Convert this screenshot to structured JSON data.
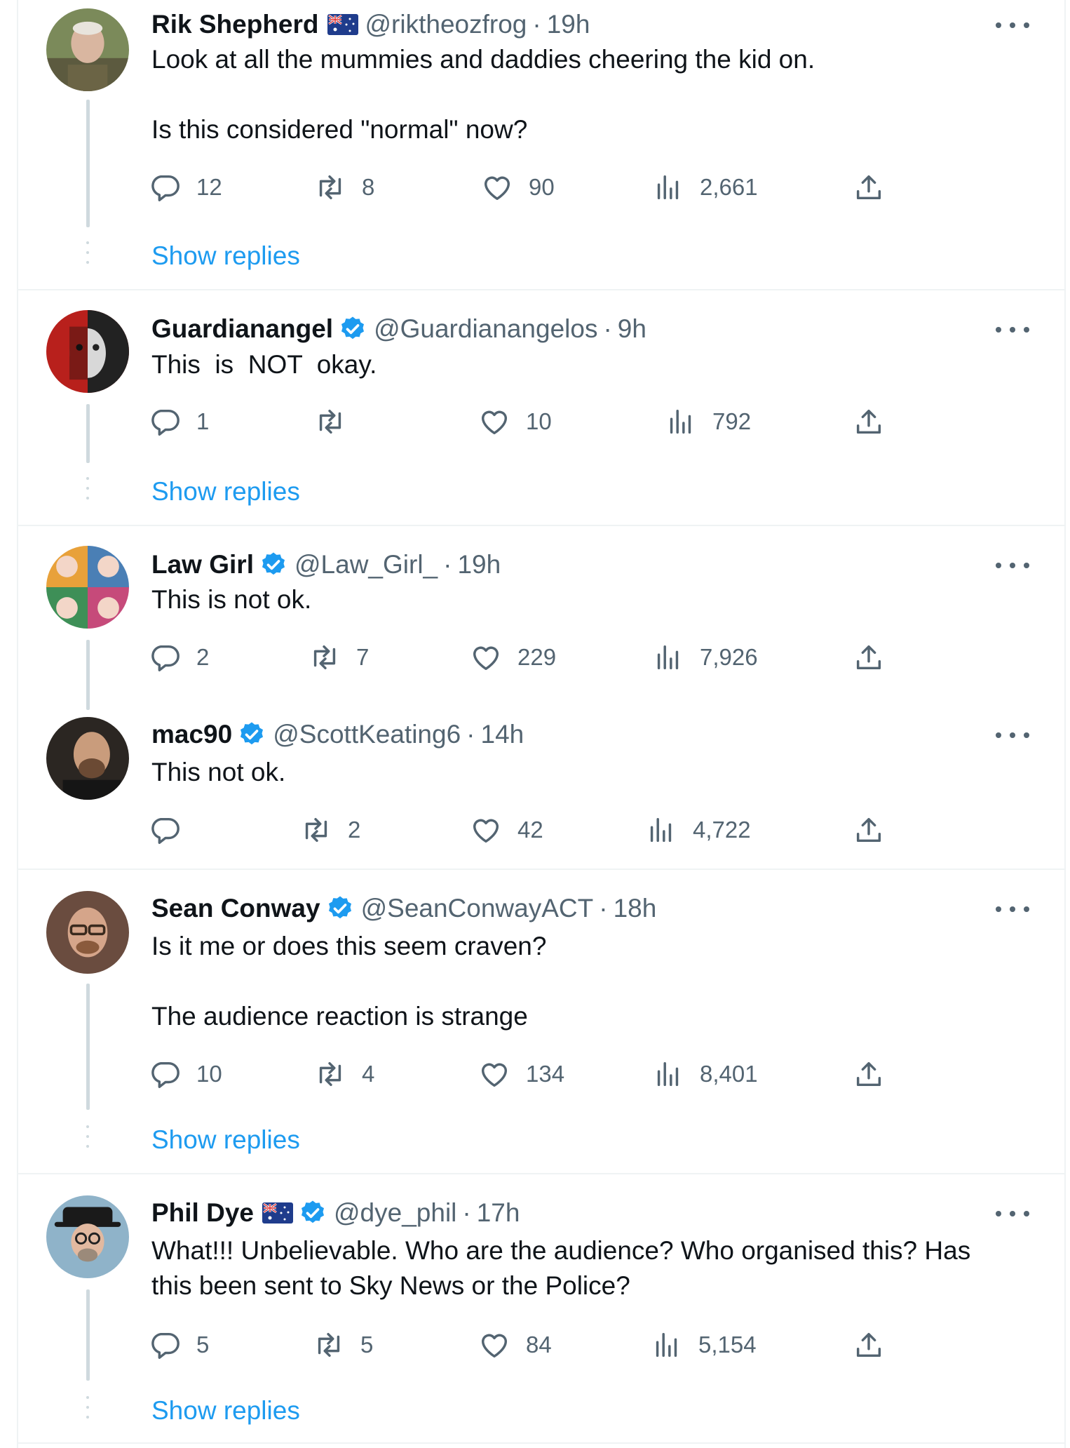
{
  "tweets": [
    {
      "name": "Rik Shepherd",
      "flag": "australian-flag",
      "verified": false,
      "handle": "@riktheozfrog",
      "sep": "·",
      "time": "19h",
      "text": "Look at all the mummies and daddies cheering the kid on.\n\nIs this considered \"normal\" now?",
      "replies": "12",
      "retweets": "8",
      "likes": "90",
      "views": "2,661",
      "show_replies": "Show replies"
    },
    {
      "name": "Guardianangel",
      "verified": true,
      "handle": "@Guardianangelos",
      "sep": "·",
      "time": "9h",
      "text": "This  is  NOT  okay.",
      "replies": "1",
      "retweets": "",
      "likes": "10",
      "views": "792",
      "show_replies": "Show replies"
    },
    {
      "name": "Law Girl",
      "verified": true,
      "handle": "@Law_Girl_",
      "sep": "·",
      "time": "19h",
      "text": "This is not ok.",
      "replies": "2",
      "retweets": "7",
      "likes": "229",
      "views": "7,926"
    },
    {
      "name": "mac90",
      "verified": true,
      "handle": "@ScottKeating6",
      "sep": "·",
      "time": "14h",
      "text": "This not ok.",
      "replies": "",
      "retweets": "2",
      "likes": "42",
      "views": "4,722"
    },
    {
      "name": "Sean Conway",
      "verified": true,
      "handle": "@SeanConwayACT",
      "sep": "·",
      "time": "18h",
      "text": "Is it me or does this seem craven?\n\nThe audience reaction is strange",
      "replies": "10",
      "retweets": "4",
      "likes": "134",
      "views": "8,401",
      "show_replies": "Show replies"
    },
    {
      "name": "Phil Dye",
      "flag": "australian-flag",
      "verified": true,
      "handle": "@dye_phil",
      "sep": "·",
      "time": "17h",
      "text": "What!!! Unbelievable. Who are the audience? Who organised this? Has\nthis been sent to Sky News or the Police?",
      "replies": "5",
      "retweets": "5",
      "likes": "84",
      "views": "5,154",
      "show_replies": "Show replies"
    }
  ],
  "colors": {
    "link_blue": "#1d9bf0",
    "muted": "#536471",
    "divider": "#eff3f4",
    "thread_line": "#cfd9de",
    "verified_blue": "#1d9bf0"
  },
  "icons": {
    "reply": "reply-icon",
    "retweet": "retweet-icon",
    "like": "heart-icon",
    "views": "views-icon",
    "share": "share-icon",
    "more": "more-icon"
  }
}
